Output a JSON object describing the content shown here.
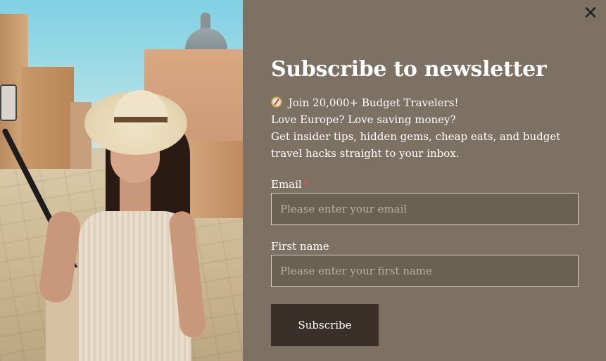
{
  "close": {
    "symbol": "✕"
  },
  "newsletter": {
    "title": "Subscribe to newsletter",
    "description": [
      "Join 20,000+ Budget Travelers!",
      "Love Europe? Love saving money?",
      "Get insider tips, hidden gems, cheap eats, and budget",
      "travel hacks straight to your inbox."
    ],
    "email": {
      "label": "Email",
      "required_marker": "*",
      "value": "",
      "placeholder": "Please enter your email"
    },
    "first_name": {
      "label": "First name",
      "value": "",
      "placeholder": "Please enter your first name"
    },
    "submit_label": "Subscribe"
  },
  "icons": {
    "description_icon": "compass-icon"
  },
  "colors": {
    "panel_bg": "#7c7163",
    "input_bg": "#6b6153",
    "button_bg": "#3a3029",
    "required": "#d9534f"
  }
}
